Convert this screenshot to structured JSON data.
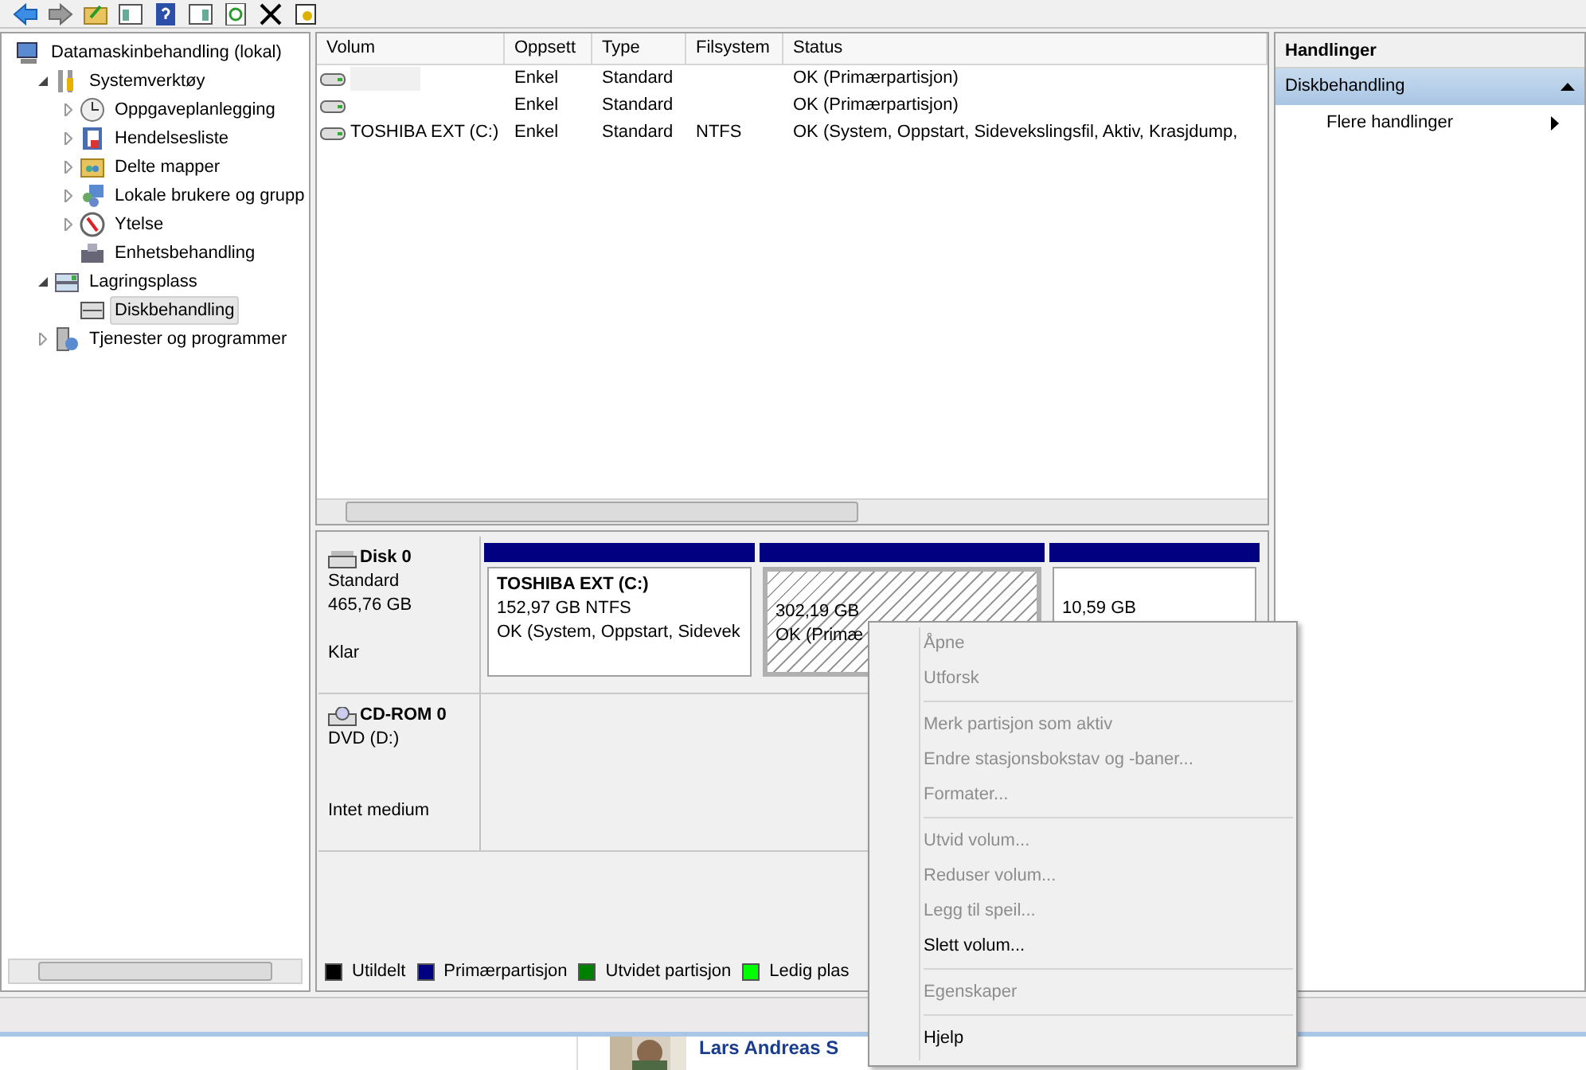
{
  "tree": [
    {
      "label": "Datamaskinbehandling (lokal)",
      "kind": "root",
      "selected": false,
      "children": [
        {
          "label": "Systemverktøy",
          "kind": "branch",
          "expanded": true,
          "selected": false,
          "children": [
            {
              "label": "Oppgaveplanlegging",
              "kind": "branch",
              "expanded": false,
              "selected": false
            },
            {
              "label": "Hendelsesliste",
              "kind": "branch",
              "expanded": false,
              "selected": false
            },
            {
              "label": "Delte mapper",
              "kind": "branch",
              "expanded": false,
              "selected": false
            },
            {
              "label": "Lokale brukere og grupp",
              "kind": "branch",
              "expanded": false,
              "selected": false
            },
            {
              "label": "Ytelse",
              "kind": "branch",
              "expanded": false,
              "selected": false
            },
            {
              "label": "Enhetsbehandling",
              "kind": "leaf",
              "selected": false
            }
          ]
        },
        {
          "label": "Lagringsplass",
          "kind": "branch",
          "expanded": true,
          "selected": false,
          "children": [
            {
              "label": "Diskbehandling",
              "kind": "leaf",
              "selected": true
            }
          ]
        },
        {
          "label": "Tjenester og programmer",
          "kind": "branch",
          "expanded": false,
          "selected": false
        }
      ]
    }
  ],
  "table": {
    "columns": [
      "Volum",
      "Oppsett",
      "Type",
      "Filsystem",
      "Status"
    ],
    "rows": [
      {
        "oppsett": "Enkel",
        "type": "Standard",
        "status": "OK (Primærpartisjon)",
        "selected": true
      },
      {
        "oppsett": "Enkel",
        "type": "Standard",
        "status": "OK (Primærpartisjon)",
        "selected": false
      },
      {
        "volum": "TOSHIBA EXT (C:)",
        "oppsett": "Enkel",
        "type": "Standard",
        "filsystem": "NTFS",
        "status": "OK (System, Oppstart, Sidevekslingsfil, Aktiv, Krasjdump,",
        "selected": false
      }
    ]
  },
  "disks": [
    {
      "name": "Disk 0",
      "lines": [
        "Standard",
        "465,76 GB"
      ],
      "state": "Klar",
      "partitions": [
        {
          "label": "TOSHIBA EXT  (C:)",
          "size": "152,97 GB NTFS",
          "status": "OK (System, Oppstart, Sidevek",
          "selected": false
        },
        {
          "size": "302,19 GB",
          "status": "OK (Primæ",
          "selected": true
        },
        {
          "size": "10,59 GB",
          "selected": false
        }
      ]
    },
    {
      "name": "CD-ROM 0",
      "lines": [
        "DVD (D:)"
      ],
      "state": "Intet medium"
    }
  ],
  "legend": [
    {
      "label": "Utildelt",
      "color": "#000000"
    },
    {
      "label": "Primærpartisjon",
      "color": "#000080"
    },
    {
      "label": "Utvidet partisjon",
      "color": "#008000"
    },
    {
      "label": "Ledig plas",
      "color": "#00ff00"
    }
  ],
  "actions": {
    "title": "Handlinger",
    "section": "Diskbehandling",
    "items": [
      "Flere handlinger"
    ]
  },
  "context_menu": [
    [
      {
        "label": "Åpne",
        "disabled": true
      },
      {
        "label": "Utforsk",
        "disabled": true
      }
    ],
    [
      {
        "label": "Merk partisjon som aktiv",
        "disabled": true
      },
      {
        "label": "Endre stasjonsbokstav og -baner...",
        "disabled": true
      },
      {
        "label": "Formater...",
        "disabled": true
      }
    ],
    [
      {
        "label": "Utvid volum...",
        "disabled": true
      },
      {
        "label": "Reduser volum...",
        "disabled": true
      },
      {
        "label": "Legg til speil...",
        "disabled": true
      },
      {
        "label": "Slett volum...",
        "disabled": false
      }
    ],
    [
      {
        "label": "Egenskaper",
        "disabled": true
      }
    ],
    [
      {
        "label": "Hjelp",
        "disabled": false
      }
    ]
  ],
  "background_page": {
    "heading": "Lars Andreas S"
  }
}
